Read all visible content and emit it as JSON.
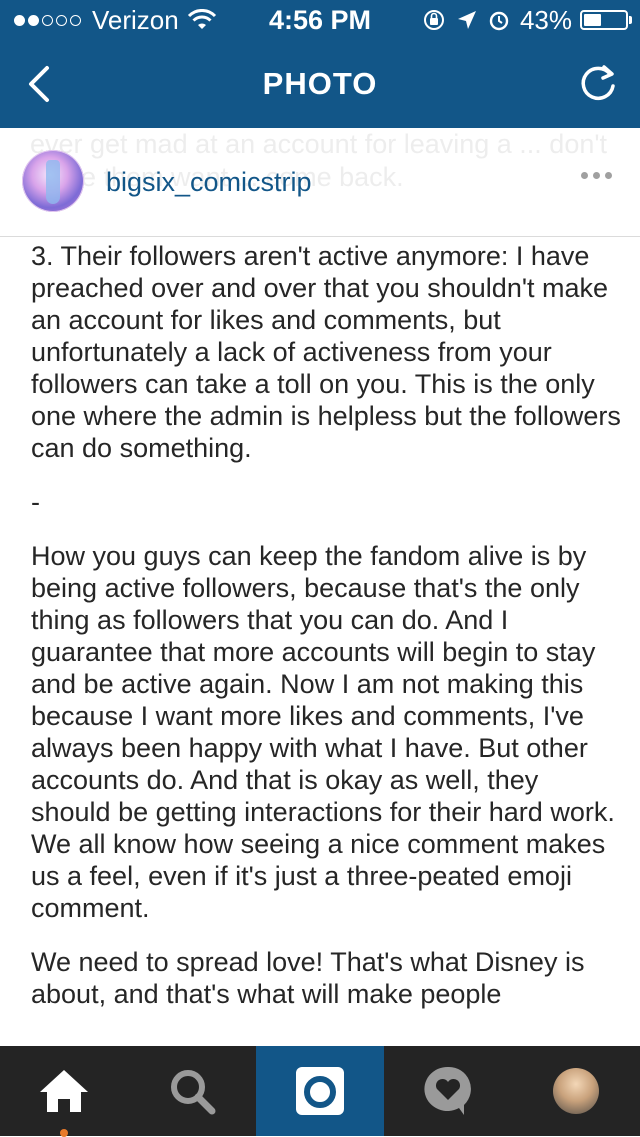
{
  "status_bar": {
    "carrier": "Verizon",
    "time": "4:56 PM",
    "battery": "43%",
    "battery_level": 0.43,
    "signal_bars_filled": 2,
    "signal_bars_total": 5
  },
  "nav": {
    "title": "PHOTO"
  },
  "post": {
    "username": "bigsix_comicstrip",
    "ghost_text": "ever get mad at an account for leaving a ... don't make them want ... come back.",
    "caption": [
      "3. Their followers aren't active anymore: I have preached over and over that you shouldn't make an account for likes and comments, but unfortunately a lack of activeness from your followers can take a toll on you. This is the only one where the admin is helpless but the followers can do something.",
      "-",
      "How you guys can keep the fandom alive is by being active followers, because that's the only thing as followers that you can do. And I guarantee that more accounts will begin to stay and be active again. Now I am not making this because I want more likes and comments, I've always been happy with what I have. But other accounts do. And that is okay as well, they should be getting interactions for their hard work. We all know how seeing a nice comment makes us a feel, even if it's just a three-peated emoji comment.",
      "We need to spread love! That's what Disney is about, and that's what will make people"
    ]
  },
  "tabbar": {
    "tabs": [
      "home-icon",
      "search-icon",
      "camera-icon",
      "activity-icon",
      "profile-avatar"
    ],
    "active": "home"
  },
  "colors": {
    "brand": "#125688",
    "tabbar": "#242424",
    "notification": "#e87a2a"
  }
}
